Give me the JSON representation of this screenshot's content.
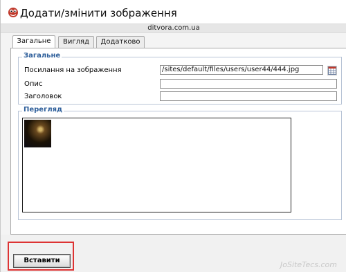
{
  "window": {
    "title": "Додати/змінити зображення",
    "domain": "ditvora.com.ua"
  },
  "tabs": [
    {
      "label": "Загальне",
      "active": true
    },
    {
      "label": "Вигляд",
      "active": false
    },
    {
      "label": "Додатково",
      "active": false
    }
  ],
  "general": {
    "legend": "Загальне",
    "image_url_label": "Посилання на зображення",
    "image_url_value": "/sites/default/files/users/user44/444.jpg",
    "description_label": "Опис",
    "description_value": "",
    "title_label": "Заголовок",
    "title_value": ""
  },
  "preview": {
    "legend": "Перегляд"
  },
  "actions": {
    "insert_label": "Вставити"
  },
  "watermark": {
    "text": "JoSiteTecs.com"
  },
  "icons": {
    "app": "tinymce-icon",
    "browse": "browse-grid-icon"
  }
}
